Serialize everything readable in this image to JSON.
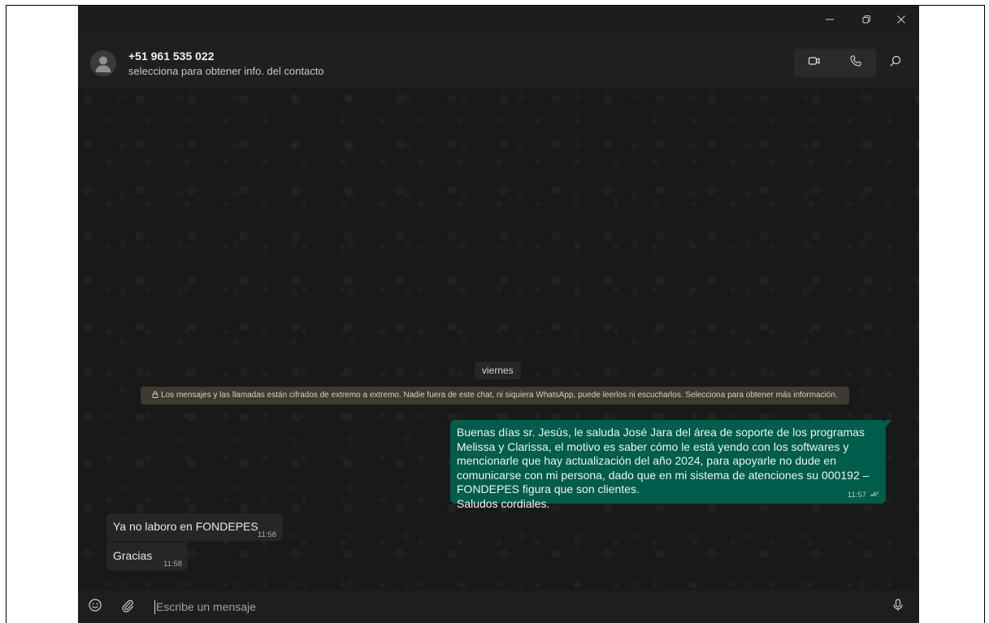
{
  "window": {
    "controls": [
      "minimize-icon",
      "restore-icon",
      "close-icon"
    ]
  },
  "header": {
    "contact_name": "+51 961 535 022",
    "contact_subtitle": "selecciona para obtener info. del contacto",
    "icons": [
      "video-call-icon",
      "voice-call-icon",
      "search-icon"
    ]
  },
  "chat": {
    "date_separator": "viernes",
    "encryption_notice": "Los mensajes y las llamadas están cifrados de extremo a extremo. Nadie fuera de este chat, ni siquiera WhatsApp, puede leerlos ni escucharlos. Selecciona para obtener más información.",
    "messages": [
      {
        "direction": "outgoing",
        "text": "Buenas días sr. Jesús, le saluda José Jara del área de soporte de los programas Melissa y Clarissa, el motivo es saber cómo le está yendo con los softwares y mencionarle que hay actualización del año 2024, para apoyarle no dude en comunicarse con mi persona, dado que en mi sistema de atenciones su 000192 – FONDEPES figura que son clientes.\nSaludos cordiales.",
        "time": "11:57",
        "status": "read"
      },
      {
        "direction": "incoming",
        "text": "Ya no laboro en FONDEPES",
        "time": "11:58"
      },
      {
        "direction": "incoming",
        "text": "Gracias",
        "time": "11:58"
      }
    ]
  },
  "composer": {
    "placeholder": "Escribe un mensaje",
    "icons": [
      "emoji-icon",
      "attach-icon",
      "microphone-icon"
    ]
  },
  "colors": {
    "outgoing_bubble": "#005c4b",
    "incoming_bubble": "#262626",
    "encryption_notice_bg": "#3f3a31",
    "app_background": "#171717"
  }
}
